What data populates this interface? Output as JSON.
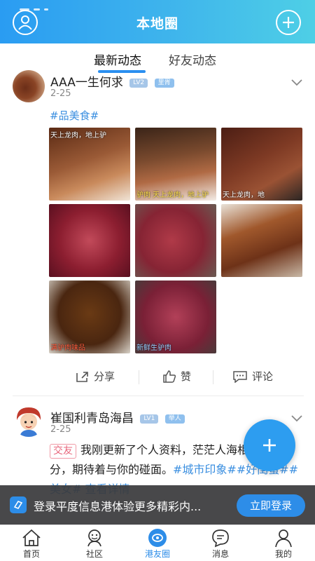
{
  "header": {
    "title": "本地圈",
    "left_icon": "user-icon",
    "right_icon": "plus-circle-icon",
    "gradient": [
      "#2a9cf2",
      "#4ecfe6"
    ]
  },
  "tabs": [
    {
      "label": "最新动态",
      "active": true
    },
    {
      "label": "好友动态",
      "active": false
    }
  ],
  "posts": [
    {
      "username": "AAA一生何求",
      "level": "LV2",
      "role": "里胥",
      "date": "2-25",
      "topic": "#品美食#",
      "images": [
        {
          "caption": "天上龙肉，地上驴",
          "icon": "braised-meat-photo"
        },
        {
          "caption": "驴肉  天上龙肉，地上驴",
          "icon": "sliced-meat-photo"
        },
        {
          "caption": "天上龙肉，地",
          "icon": "packaged-meat-photo"
        },
        {
          "caption": "",
          "icon": "raw-meat-photo"
        },
        {
          "caption": "",
          "icon": "raw-meat-cubes-photo"
        },
        {
          "caption": "",
          "icon": "braised-meat-closeup-photo"
        },
        {
          "caption": "满驴肉味品",
          "icon": "braised-bones-photo"
        },
        {
          "caption": "新鲜生驴肉",
          "icon": "fresh-meat-photo"
        }
      ],
      "actions": {
        "share": "分享",
        "like": "赞",
        "comment": "评论"
      }
    },
    {
      "username": "崔国利青岛海昌",
      "level": "LV1",
      "role": "举人",
      "date": "2-25",
      "tag": "交友",
      "text": "我刚更新了个人资料，茫茫人海相遇就是缘分，期待着与你的碰面。",
      "hashtags": "#城市印象##好闺蜜##美女#",
      "more": "查看详情"
    }
  ],
  "fab": {
    "icon": "plus-icon",
    "color": "#2d9df0"
  },
  "login_banner": {
    "text": "登录平度信息港体验更多精彩内...",
    "button": "立即登录"
  },
  "bottom_nav": [
    {
      "label": "首页",
      "icon": "home-icon",
      "active": false
    },
    {
      "label": "社区",
      "icon": "community-icon",
      "active": false
    },
    {
      "label": "港友圈",
      "icon": "circle-icon",
      "active": true
    },
    {
      "label": "消息",
      "icon": "message-icon",
      "active": false
    },
    {
      "label": "我的",
      "icon": "profile-icon",
      "active": false
    }
  ],
  "accent_color": "#2d8de8"
}
